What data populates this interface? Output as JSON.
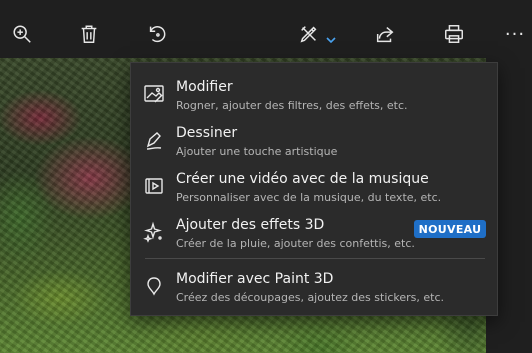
{
  "toolbar": {
    "icons": [
      "zoom-in-icon",
      "trash-icon",
      "rotate-icon",
      "edit-create-icon",
      "chevron-down-icon",
      "share-icon",
      "print-icon",
      "more-icon"
    ],
    "more_label": "···"
  },
  "menu": {
    "items": [
      {
        "title": "Modifier",
        "description": "Rogner, ajouter des filtres, des effets, etc.",
        "icon": "edit-photo-icon"
      },
      {
        "title": "Dessiner",
        "description": "Ajouter une touche artistique",
        "icon": "pen-draw-icon"
      },
      {
        "title": "Créer une vidéo avec de la musique",
        "description": "Personnaliser avec de la musique, du texte, etc.",
        "icon": "video-icon"
      },
      {
        "title": "Ajouter des effets 3D",
        "description": "Créer de la pluie, ajouter des confettis, etc.",
        "icon": "sparkle-3d-icon",
        "badge": "NOUVEAU"
      },
      {
        "title": "Modifier avec Paint 3D",
        "description": "Créez des découpages, ajoutez des stickers, etc.",
        "icon": "paint-3d-icon"
      }
    ]
  },
  "colors": {
    "background": "#1f1f1f",
    "menu": "#2b2b2b",
    "accent": "#1f6fc7",
    "chevron": "#4aa3f0"
  }
}
